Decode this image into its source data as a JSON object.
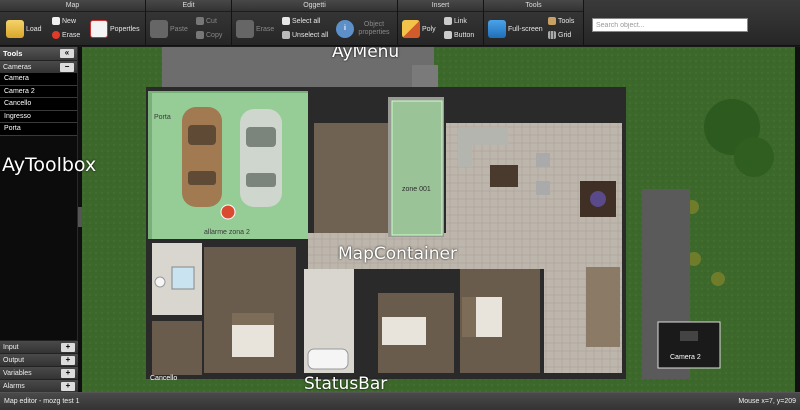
{
  "ribbon": {
    "groups": {
      "map": {
        "title": "Map",
        "load": "Load",
        "new": "New",
        "erase": "Erase",
        "properties": "Popertles"
      },
      "edit": {
        "title": "Edit",
        "paste": "Paste",
        "cut": "Cut",
        "copy": "Copy"
      },
      "oggetti": {
        "title": "Oggetti",
        "erase": "Erase",
        "select_all": "Select all",
        "unselect_all": "Unselect all",
        "object_properties": "Object properties"
      },
      "insert": {
        "title": "Insert",
        "poly": "Poly",
        "link": "Link",
        "button": "Button"
      },
      "tools": {
        "title": "Tools",
        "fullscreen": "Full-screen",
        "tools": "Tools",
        "grid": "Grid"
      }
    },
    "search": {
      "placeholder": "Search object..."
    }
  },
  "toolbox": {
    "title": "Tools",
    "collapse_label": "«",
    "cameras": {
      "label": "Cameras",
      "toggle": "−",
      "items": [
        "Camera",
        "Camera 2",
        "Cancello",
        "Ingresso",
        "Porta"
      ]
    },
    "bottom_sections": [
      {
        "label": "Input",
        "toggle": "+"
      },
      {
        "label": "Output",
        "toggle": "+"
      },
      {
        "label": "Variables",
        "toggle": "+"
      },
      {
        "label": "Alarms",
        "toggle": "+"
      }
    ]
  },
  "map": {
    "labels": {
      "porta": "Porta",
      "alarm_zone": "allarme zona 2",
      "zone": "zone 001",
      "camera2": "Camera 2",
      "cancello": "Cancello"
    }
  },
  "annotations": {
    "aymenu": "AyMenu",
    "aytoolbox": "AyToolbox",
    "mapcontainer": "MapContainer",
    "statusbar": "StatusBar"
  },
  "status": {
    "left": "Map editor - mozg test 1",
    "right": "Mouse x=7, y=209"
  },
  "colors": {
    "ribbon_bg": "#2e2e2e",
    "zone_highlight": "#9be89b",
    "alarm": "#d94a30",
    "grass": "#3e6a2c",
    "wall": "#2a2a2a"
  }
}
